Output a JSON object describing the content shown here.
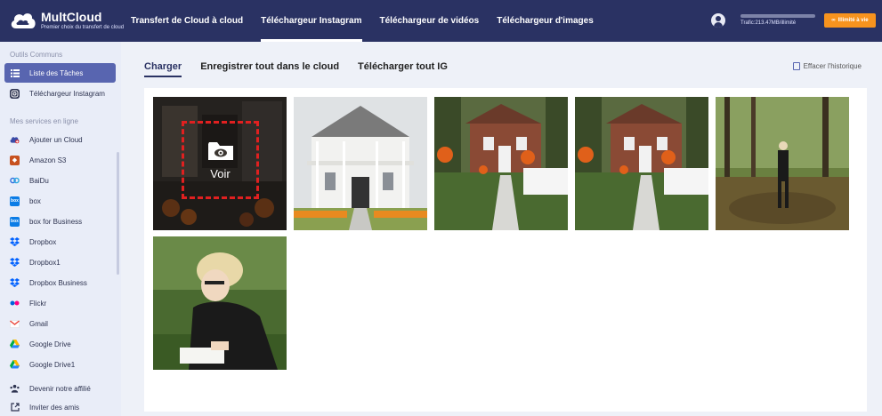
{
  "header": {
    "brand_name": "MultCloud",
    "brand_tagline": "Premier choix du transfert de cloud",
    "nav": [
      {
        "label": "Transfert de Cloud à cloud",
        "active": false
      },
      {
        "label": "Téléchargeur Instagram",
        "active": true
      },
      {
        "label": "Téléchargeur de vidéos",
        "active": false
      },
      {
        "label": "Téléchargeur d'images",
        "active": false
      }
    ],
    "traffic_text": "Trafic:213.47MB/illimité",
    "upgrade_label": "Illimité à vie"
  },
  "sidebar": {
    "section_common": "Outils Communs",
    "common_items": [
      {
        "label": "Liste des Tâches",
        "icon": "list-icon",
        "active": true
      },
      {
        "label": "Téléchargeur Instagram",
        "icon": "instagram-icon",
        "active": false
      }
    ],
    "section_services": "Mes services en ligne",
    "service_items": [
      {
        "label": "Ajouter un Cloud",
        "icon": "add-cloud-icon"
      },
      {
        "label": "Amazon S3",
        "icon": "amazon-s3-icon"
      },
      {
        "label": "BaiDu",
        "icon": "baidu-icon"
      },
      {
        "label": "box",
        "icon": "box-icon"
      },
      {
        "label": "box for Business",
        "icon": "box-business-icon"
      },
      {
        "label": "Dropbox",
        "icon": "dropbox-icon"
      },
      {
        "label": "Dropbox1",
        "icon": "dropbox-icon"
      },
      {
        "label": "Dropbox Business",
        "icon": "dropbox-business-icon"
      },
      {
        "label": "Flickr",
        "icon": "flickr-icon"
      },
      {
        "label": "Gmail",
        "icon": "gmail-icon"
      },
      {
        "label": "Google Drive",
        "icon": "google-drive-icon"
      },
      {
        "label": "Google Drive1",
        "icon": "google-drive-icon"
      }
    ],
    "bottom_items": [
      {
        "label": "Devenir notre affilié",
        "icon": "affiliate-icon"
      },
      {
        "label": "Inviter des amis",
        "icon": "invite-icon"
      }
    ]
  },
  "main": {
    "tabs": [
      {
        "label": "Charger",
        "active": true
      },
      {
        "label": "Enregistrer tout dans le cloud",
        "active": false
      },
      {
        "label": "Télécharger tout IG",
        "active": false
      }
    ],
    "clear_history": "Effacer l'historique",
    "overlay_label": "Voir"
  },
  "colors": {
    "header_bg": "#2a3263",
    "sidebar_bg": "#e9edf8",
    "active_item": "#5865b0",
    "upgrade": "#f7931e",
    "overlay_border": "#e02020"
  }
}
